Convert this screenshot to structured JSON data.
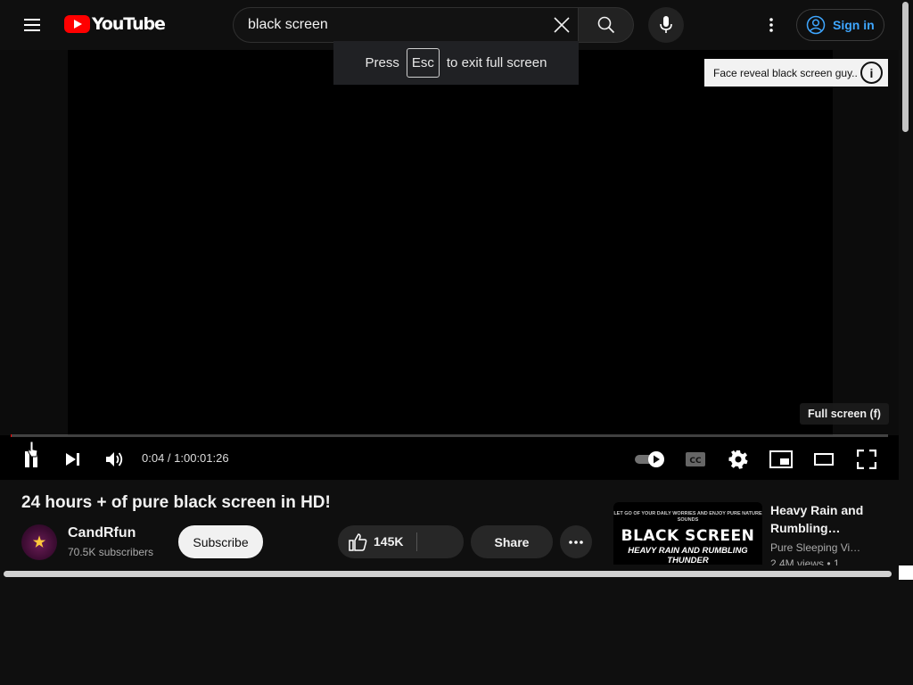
{
  "header": {
    "logo_text": "YouTube",
    "search_value": "black screen",
    "signin_label": "Sign in"
  },
  "player": {
    "esc_prefix": "Press",
    "esc_key": "Esc",
    "esc_suffix": "to exit full screen",
    "card_teaser": "Face reveal black screen guy..",
    "fullscreen_tooltip": "Full screen (f)",
    "time": "0:04 / 1:00:01:26",
    "progress": 0.0001
  },
  "video": {
    "title": "24 hours + of pure black screen in HD!",
    "channel": "CandRfun",
    "subscribers": "70.5K subscribers",
    "subscribe_label": "Subscribe",
    "likes": "145K",
    "share_label": "Share"
  },
  "recommendation": {
    "thumb_small": "LET GO OF YOUR DAILY WORRIES AND ENJOY PURE NATURE SOUNDS",
    "thumb_big": "BLACK SCREEN",
    "thumb_sub": "HEAVY RAIN AND RUMBLING THUNDER",
    "title": "Heavy Rain and Rumbling…",
    "channel": "Pure Sleeping Vi…",
    "meta": "2.4M views  • 1"
  },
  "colors": {
    "brand_red": "#ff0000",
    "link_blue": "#3ea6ff",
    "background": "#0f0f0f"
  }
}
